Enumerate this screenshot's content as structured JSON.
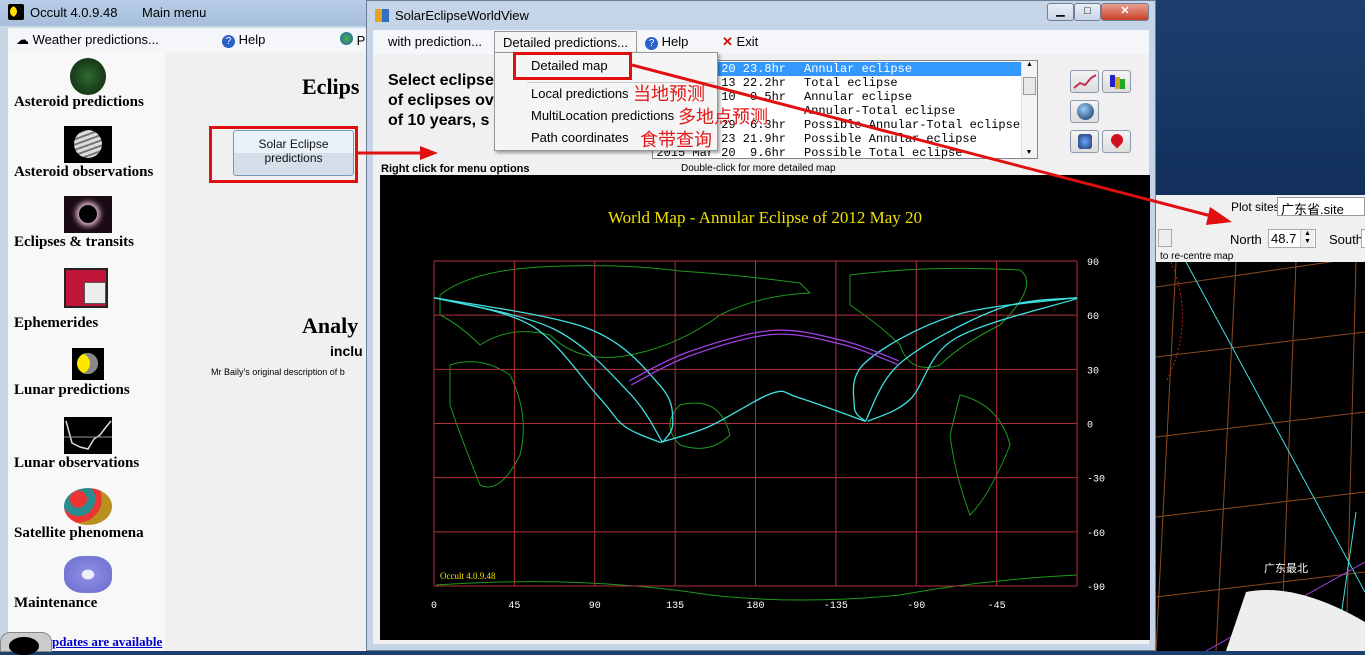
{
  "main_window": {
    "title": "Occult 4.0.9.48",
    "subtitle": "Main menu",
    "menu": [
      "Weather predictions...",
      "Help",
      "P"
    ],
    "left_items": [
      "Asteroid predictions",
      "Asteroid observations",
      "Eclipses & transits",
      "Ephemerides",
      "Lunar predictions",
      "Lunar observations",
      "Satellite phenomena",
      "Maintenance"
    ],
    "updates_link": "pdates are available",
    "heading": "Eclips",
    "solar_button": "Solar Eclipse predictions",
    "analysis_heading": "Analy",
    "analysis_sub": "inclu",
    "analysis_desc": "Mr Baily's original description of b"
  },
  "eclipse_window": {
    "title": "SolarEclipseWorldView",
    "menu": {
      "with_prediction": "with prediction...",
      "detailed": "Detailed predictions...",
      "help": "Help",
      "exit": "Exit"
    },
    "dropdown": [
      "Detailed map",
      "Local predictions",
      "MultiLocation predictions",
      "Path coordinates"
    ],
    "annotations": [
      "当地预测",
      "多地点预测",
      "食带查询"
    ],
    "select_text": [
      "Select eclipse",
      "of eclipses ov",
      "of 10 years, s"
    ],
    "right_click_hint": "Right click for menu options",
    "double_click_hint": "Double-click for more detailed map",
    "list": [
      {
        "dt": "20 23.8hr",
        "type": "Annular eclipse",
        "selected": true
      },
      {
        "dt": "13 22.2hr",
        "type": "Total eclipse"
      },
      {
        "dt": "10  0.5hr",
        "type": "Annular eclipse"
      },
      {
        "dt": "",
        "type": "Annular-Total eclipse"
      },
      {
        "dt": "29  6.3hr",
        "type": "Possible Annular-Total eclipse"
      },
      {
        "dt": "23 21.9hr",
        "type": "Possible Annular eclipse"
      },
      {
        "dt": "2015 Mar 20  9.6hr",
        "type": "Possible Total eclipse"
      }
    ],
    "tool_icons": [
      "chart-icon",
      "multi-color-icon",
      "google-earth-icon",
      "google-earth-file-icon",
      "map-pin-icon"
    ]
  },
  "right_window": {
    "plot_sites_label": "Plot sites",
    "plot_sites_value": "广东省.site",
    "north_label": "North",
    "north_value": "48.7",
    "south_label": "South",
    "recentre_hint": "to re-centre map",
    "map_text": "广东最北"
  },
  "chart_data": {
    "type": "line",
    "title": "World Map  -  Annular  Eclipse  of  2012 May 20",
    "watermark": "Occult 4.0.9.48",
    "x_ticks": [
      "0",
      "45",
      "90",
      "135",
      "180",
      "-135",
      "-90",
      "-45"
    ],
    "y_ticks": [
      "90",
      "60",
      "30",
      "0",
      "-30",
      "-60",
      "-90"
    ],
    "xlim": [
      0,
      360
    ],
    "ylim": [
      -90,
      90
    ],
    "grid": true,
    "colors": {
      "grid": "#b0303a",
      "coast": "#1e9a1e",
      "limits": "#40e0e0",
      "central": "#a040e0",
      "title": "#f0e000"
    },
    "series": [
      {
        "kind": "limit",
        "points": [
          [
            0,
            69.7
          ],
          [
            86.8,
            52.4
          ],
          [
            126.7,
            20.8
          ],
          [
            133.7,
            0.3
          ],
          [
            128,
            -10.5
          ]
        ]
      },
      {
        "kind": "limit",
        "points": [
          [
            0,
            69.7
          ],
          [
            66.9,
            52.4
          ],
          [
            109.3,
            17
          ],
          [
            128,
            -10.5
          ]
        ]
      },
      {
        "kind": "limit",
        "points": [
          [
            0,
            69.7
          ],
          [
            54.4,
            54.3
          ],
          [
            91.8,
            15.2
          ],
          [
            106.8,
            -1.6
          ],
          [
            126.7,
            -10.5
          ]
        ]
      },
      {
        "kind": "limit",
        "points": [
          [
            126.7,
            -10.5
          ],
          [
            154.2,
            -1.6
          ],
          [
            189.1,
            16.7
          ],
          [
            204.1,
            14.3
          ],
          [
            241.5,
            1.2
          ]
        ]
      },
      {
        "kind": "limit",
        "points": [
          [
            241.5,
            1.2
          ],
          [
            261.5,
            33.8
          ],
          [
            316.4,
            63.6
          ],
          [
            360,
            69.7
          ]
        ]
      },
      {
        "kind": "limit",
        "points": [
          [
            241.5,
            1.2
          ],
          [
            235.3,
            9.6
          ],
          [
            241.5,
            33.8
          ],
          [
            291.4,
            59.9
          ],
          [
            360,
            69.7
          ]
        ]
      },
      {
        "kind": "limit",
        "points": [
          [
            242.8,
            1.2
          ],
          [
            266.5,
            13.3
          ],
          [
            291.4,
            46.8
          ],
          [
            360,
            69.2
          ]
        ]
      },
      {
        "kind": "central",
        "points": [
          [
            109.3,
            23.6
          ],
          [
            141.7,
            39.4
          ],
          [
            189.1,
            51.5
          ],
          [
            229,
            45.9
          ],
          [
            260.2,
            34.7
          ]
        ]
      },
      {
        "kind": "central",
        "points": [
          [
            110.5,
            21.4
          ],
          [
            142.5,
            37.2
          ],
          [
            189.1,
            49.3
          ],
          [
            229,
            43.7
          ],
          [
            260.2,
            32.5
          ]
        ]
      }
    ]
  }
}
